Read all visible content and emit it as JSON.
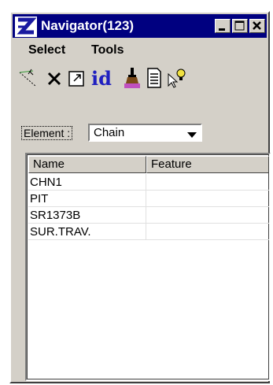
{
  "window": {
    "title": "Navigator(123)"
  },
  "menu": {
    "items": [
      "Select",
      "Tools"
    ]
  },
  "toolbar": {
    "tools": [
      "select-line-icon",
      "delete-x-icon",
      "locate-arrow-icon",
      "id-icon",
      "paint-brush-icon",
      "report-icon",
      "cursor-bulb-icon"
    ],
    "id_text": "id"
  },
  "filter": {
    "label": "Element :",
    "selected": "Chain"
  },
  "table": {
    "columns": [
      "Name",
      "Feature"
    ],
    "rows": [
      {
        "name": "CHN1",
        "feature": ""
      },
      {
        "name": "PIT",
        "feature": ""
      },
      {
        "name": "SR1373B",
        "feature": ""
      },
      {
        "name": "SUR.TRAV.",
        "feature": ""
      }
    ]
  },
  "colors": {
    "titlebar": "#000080",
    "face": "#d4d0c8",
    "accent": "#2020c0"
  }
}
